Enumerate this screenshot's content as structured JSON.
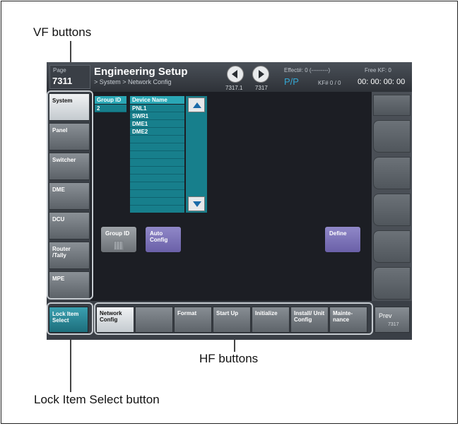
{
  "callouts": {
    "vf": "VF buttons",
    "hf": "HF buttons",
    "lock": "Lock Item Select button"
  },
  "header": {
    "page_label": "Page",
    "page_number": "7311",
    "title": "Engineering Setup",
    "path": "> System > Network Config",
    "prev_page": "7317.1",
    "next_page": "7317",
    "effect": "Effect#: 0 (---------)",
    "free_kf": "Free KF: 0",
    "mode": "P/P",
    "kf": "KF# 0 / 0",
    "timecode": "00: 00: 00: 00"
  },
  "vf_buttons": [
    {
      "label": "System",
      "selected": true
    },
    {
      "label": "Panel"
    },
    {
      "label": "Switcher"
    },
    {
      "label": "DME"
    },
    {
      "label": "DCU"
    },
    {
      "label": "Router /Tally"
    },
    {
      "label": "MPE"
    }
  ],
  "group_list": {
    "header": "Group ID",
    "rows": [
      "2"
    ]
  },
  "device_list": {
    "header": "Device Name",
    "rows": [
      "PNL1",
      "SWR1",
      "DME1",
      "DME2",
      "",
      "",
      "",
      "",
      "",
      "",
      "",
      "",
      ""
    ]
  },
  "function_buttons": {
    "group_id": "Group ID",
    "auto_config": "Auto Config",
    "define": "Define"
  },
  "lock_item_select": "Lock Item Select",
  "hf_buttons": [
    {
      "label": "Network Config",
      "selected": true
    },
    {
      "label": ""
    },
    {
      "label": "Format"
    },
    {
      "label": "Start Up"
    },
    {
      "label": "Initialize"
    },
    {
      "label": "Install/ Unit Config"
    },
    {
      "label": "Mainte- nance"
    }
  ],
  "prev_button": {
    "label": "Prev",
    "page": "7317"
  },
  "colors": {
    "accent_teal": "#177f8c",
    "selected": "#e8eaec",
    "purple_button": "#7a70b8",
    "lock_button": "#2a8a98"
  },
  "icons": {
    "nav_prev": "left-arrow-icon",
    "nav_next": "right-arrow-icon",
    "scroll_up": "triangle-up-icon",
    "scroll_down": "triangle-down-icon"
  }
}
